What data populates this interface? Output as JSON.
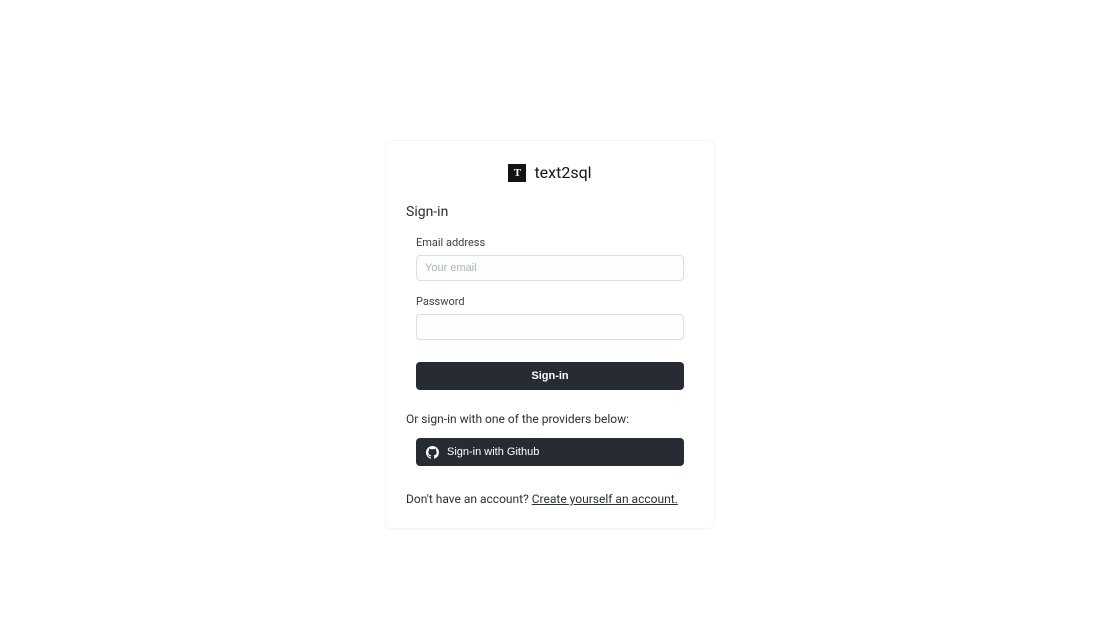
{
  "brand": {
    "logo_letter": "T",
    "name_part1": "text",
    "name_part2": "2sql"
  },
  "heading": "Sign-in",
  "form": {
    "email_label": "Email address",
    "email_placeholder": "Your email",
    "email_value": "",
    "password_label": "Password",
    "password_value": "",
    "submit_label": "Sign-in"
  },
  "providers": {
    "divider_text": "Or sign-in with one of the providers below:",
    "github_label": "Sign-in with Github"
  },
  "footer": {
    "prefix": "Don't have an account? ",
    "link_text": "Create yourself an account."
  }
}
